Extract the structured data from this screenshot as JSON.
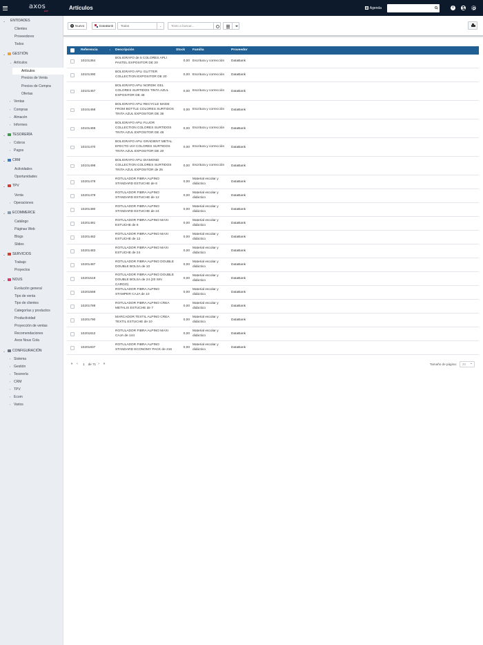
{
  "app": {
    "logo": "axos",
    "logo_sub": "ERP",
    "page_title": "Artículos",
    "agenda_label": "Agenda",
    "search_placeholder": ""
  },
  "sidebar": {
    "sections": [
      {
        "label": "ENTIDADES",
        "expanded": true,
        "items": [
          {
            "label": "Clientes"
          },
          {
            "label": "Proveedores"
          },
          {
            "label": "Todos"
          }
        ]
      },
      {
        "label": "GESTIÓN",
        "expanded": true,
        "items": [
          {
            "label": "Artículos",
            "expandable": true,
            "children": [
              {
                "label": "Artículos",
                "active": true
              },
              {
                "label": "Precios de Venta"
              },
              {
                "label": "Precios de Compra"
              },
              {
                "label": "Ofertas"
              }
            ]
          },
          {
            "label": "Ventas",
            "expandable": true
          },
          {
            "label": "Compras",
            "expandable": true
          },
          {
            "label": "Almacén",
            "expandable": true
          },
          {
            "label": "Informes",
            "expandable": true
          }
        ]
      },
      {
        "label": "TESORERÍA",
        "expanded": true,
        "items": [
          {
            "label": "Cobros",
            "expandable": true
          },
          {
            "label": "Pagos",
            "expandable": true
          }
        ]
      },
      {
        "label": "CRM",
        "expanded": true,
        "items": [
          {
            "label": "Actividades"
          },
          {
            "label": "Oportunidades"
          }
        ]
      },
      {
        "label": "TPV",
        "expanded": true,
        "items": [
          {
            "label": "Venta"
          },
          {
            "label": "Operaciones",
            "expandable": true
          }
        ]
      },
      {
        "label": "ECOMMERCE",
        "expanded": true,
        "items": [
          {
            "label": "Catálogo"
          },
          {
            "label": "Páginas Web"
          },
          {
            "label": "Blogs"
          },
          {
            "label": "Slides"
          }
        ]
      },
      {
        "label": "SERVICIOS",
        "expanded": true,
        "items": [
          {
            "label": "Trabajo"
          },
          {
            "label": "Proyectos"
          }
        ]
      },
      {
        "label": "NOUS",
        "expanded": true,
        "items": [
          {
            "label": "Evolución general"
          },
          {
            "label": "Tipo de venta"
          },
          {
            "label": "Tipo de clientes"
          },
          {
            "label": "Categorías y productos"
          },
          {
            "label": "Productividad"
          },
          {
            "label": "Proyección de ventas"
          },
          {
            "label": "Recomendaciones"
          },
          {
            "label": "Axos Nous Cola"
          }
        ]
      },
      {
        "label": "CONFIGURACIÓN",
        "expanded": true,
        "items": [
          {
            "label": "Sistema",
            "expandable": true
          },
          {
            "label": "Gestión",
            "expandable": true
          },
          {
            "label": "Tesorería",
            "expandable": true
          },
          {
            "label": "CRM",
            "expandable": true
          },
          {
            "label": "TPV",
            "expandable": true
          },
          {
            "label": "Ecom",
            "expandable": true
          },
          {
            "label": "Varios",
            "expandable": true
          }
        ]
      }
    ],
    "section_colors": {
      "ENTIDADES": "",
      "GESTIÓN": "#e8a33d",
      "TESORERÍA": "#3a9d4a",
      "CRM": "#3a78c4",
      "TPV": "#d63b2f",
      "ECOMMERCE": "#8b9bab",
      "SERVICIOS": "#d63b2f",
      "NOUS": "#d63b6a",
      "CONFIGURACIÓN": "#6c7480"
    }
  },
  "toolbar": {
    "new_label": "Nuevo",
    "databank_label": "DataBank",
    "filter_value": "Todos",
    "search_placeholder": "Texto a buscar..."
  },
  "table": {
    "headers": {
      "reference": "Referencia",
      "description": "Descripción",
      "stock": "Stock",
      "family": "Familia",
      "provider": "Proveedor"
    },
    "rows": [
      {
        "ref": "10101364",
        "desc": "BOLIGRAFO de 5 COLORES APLI PASTEL EXPOSITOR DE 20",
        "stock": "0,00",
        "family": "Escritura y corrección",
        "provider": "DataBank"
      },
      {
        "ref": "10101390",
        "desc": "BOLIGRAFO APLI GLITTER COLLECTION EXPOSITOR DE 20",
        "stock": "0,00",
        "family": "Escritura y corrección",
        "provider": "DataBank"
      },
      {
        "ref": "10101467",
        "desc": "BOLIGRAFO APLI NORDIK GEL COLORES SURTIDOS TINTA AZUL EXPOSITOR DE 48",
        "stock": "0,00",
        "family": "Escritura y corrección",
        "provider": "DataBank"
      },
      {
        "ref": "10101468",
        "desc": "BOLIGRAFO APLI RECYCLE MADE FROM BOTTLE COLORES SURTIDOS TINTA AZUL EXPOSITOR DE 36",
        "stock": "0,00",
        "family": "Escritura y corrección",
        "provider": "DataBank"
      },
      {
        "ref": "10101469",
        "desc": "BOLIGRAFO APLI FLUOR COLLECTION COLORES SURTIDOS TINTA AZUL EXPOSITOR DE 48",
        "stock": "0,00",
        "family": "Escritura y corrección",
        "provider": "DataBank"
      },
      {
        "ref": "10101470",
        "desc": "BOLIGRAFO APLI GRADIENT METAL EFECTO UVI COLORES SURTIDOS TINTA AZUL EXPOSITOR DE 20",
        "stock": "0,00",
        "family": "Escritura y corrección",
        "provider": "DataBank"
      },
      {
        "ref": "10101498",
        "desc": "BOLIGRAFO APLI DIAMOND COLLECTION COLORES SURTIDOS TINTA AZUL EXPOSITOR de 25",
        "stock": "0,00",
        "family": "Escritura y corrección",
        "provider": "DataBank"
      },
      {
        "ref": "10201478",
        "desc": "ROTULADOR FIBRA ALPINO STANDARD ESTUCHE de 6",
        "stock": "0,00",
        "family": "Material escolar y didáctico",
        "provider": "DataBank"
      },
      {
        "ref": "10201479",
        "desc": "ROTULADOR FIBRA ALPINO STANDARD ESTUCHE de 12",
        "stock": "0,00",
        "family": "Material escolar y didáctico",
        "provider": "DataBank"
      },
      {
        "ref": "10201480",
        "desc": "ROTULADOR FIBRA ALPINO STANDARD ESTUCHE de 24",
        "stock": "0,00",
        "family": "Material escolar y didáctico",
        "provider": "DataBank"
      },
      {
        "ref": "10201481",
        "desc": "ROTULADOR FIBRA ALPINO MAXI ESTUCHE de 6",
        "stock": "0,00",
        "family": "Material escolar y didáctico",
        "provider": "DataBank"
      },
      {
        "ref": "10201482",
        "desc": "ROTULADOR FIBRA ALPINO MAXI ESTUCHE de 12",
        "stock": "0,00",
        "family": "Material escolar y didáctico",
        "provider": "DataBank"
      },
      {
        "ref": "10201483",
        "desc": "ROTULADOR FIBRA ALPINO MAXI ESTUCHE de 24",
        "stock": "0,00",
        "family": "Material escolar y didáctico",
        "provider": "DataBank"
      },
      {
        "ref": "10201487",
        "desc": "ROTULADOR FIBRA ALPINO DOUBLE DOUBLE BOLSA de 10",
        "stock": "0,00",
        "family": "Material escolar y didáctico",
        "provider": "DataBank"
      },
      {
        "ref": "10201519",
        "desc": "ROTULADOR FIBRA ALPINO DOUBLE DOUBLE BOLSA de 24 (20 SIN CARGO)",
        "stock": "0,00",
        "family": "Material escolar y didáctico",
        "provider": "DataBank"
      },
      {
        "ref": "10201568",
        "desc": "ROTULADOR FIBRA ALPINO STAMPER CAJA de 10",
        "stock": "0,00",
        "family": "Material escolar y didáctico",
        "provider": "DataBank"
      },
      {
        "ref": "10201789",
        "desc": "ROTULADOR FIBRA ALPINO CREA METALIX ESTUCHE de 7",
        "stock": "0,00",
        "family": "Material escolar y didáctico",
        "provider": "DataBank"
      },
      {
        "ref": "10201790",
        "desc": "MARCADOR TEXTIL ALPINO CREA TEXTIL ESTUCHE de 10",
        "stock": "0,00",
        "family": "Material escolar y didáctico",
        "provider": "DataBank"
      },
      {
        "ref": "10201812",
        "desc": "ROTULADOR FIBRA ALPINO MAXI CAJA de 144",
        "stock": "0,00",
        "family": "Material escolar y didáctico",
        "provider": "DataBank"
      },
      {
        "ref": "10201837",
        "desc": "ROTULADOR FIBRA ALPINO STANDARD ECONOMY PACK de 216",
        "stock": "0,00",
        "family": "Material escolar y didáctico",
        "provider": "DataBank"
      }
    ]
  },
  "pagination": {
    "current_page": "1",
    "of_label": "de 71",
    "page_size_label": "Tamaño de página:",
    "page_size_value": "20"
  },
  "colors": {
    "topbar": "#0c1a2c",
    "table_header": "#1f5f93",
    "logo_accent": "#e04a62"
  }
}
